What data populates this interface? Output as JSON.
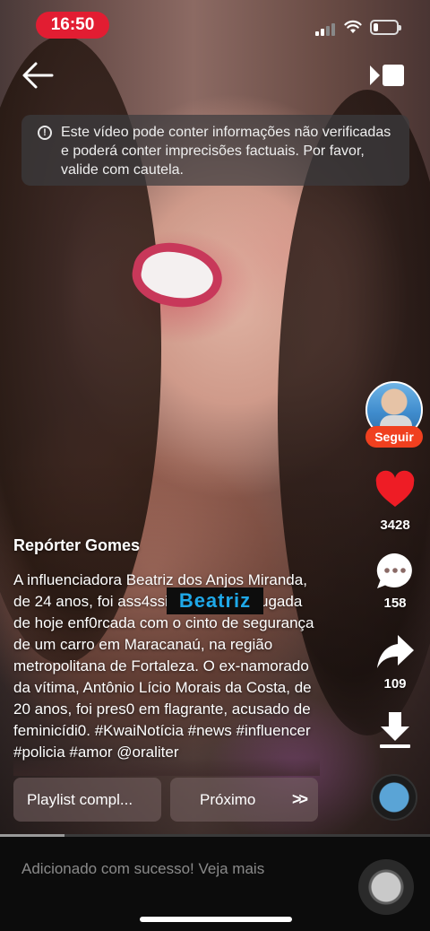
{
  "status_bar": {
    "time": "16:50",
    "battery_level": 0.2
  },
  "warning": {
    "icon": "info-circle-icon",
    "text": "Este vídeo pode conter informações não verificadas e poderá conter imprecisões factuais. Por favor, valide com cautela."
  },
  "rail": {
    "follow_label": "Seguir",
    "likes": "3428",
    "comments": "158",
    "shares": "109"
  },
  "post": {
    "author": "Repórter Gomes",
    "caption": "A influenciadora Beatriz dos Anjos Miranda, de 24 anos, foi ass4ssin*da na madrugada de hoje enf0rcada com o cinto de segurança de um carro em Maracanaú, na região metropolitana de Fortaleza. O ex-namorado da vítima, Antônio Lício Morais da Costa, de 20 anos, foi pres0 em flagrante, acusado de feminicídi0. #KwaiNotícia #news #influencer #policia #amor @oraliter",
    "overlay_text": "Beatriz"
  },
  "buttons": {
    "playlist": "Playlist compl...",
    "next": "Próximo",
    "next_arrows": ">>"
  },
  "progress": {
    "fraction": 0.15
  },
  "toast": {
    "text": "Adicionado com sucesso! Veja mais"
  },
  "colors": {
    "accent": "#e21d32",
    "follow": "#f0401f",
    "like": "#ee1c25",
    "overlay_text": "#1fa8e8"
  }
}
